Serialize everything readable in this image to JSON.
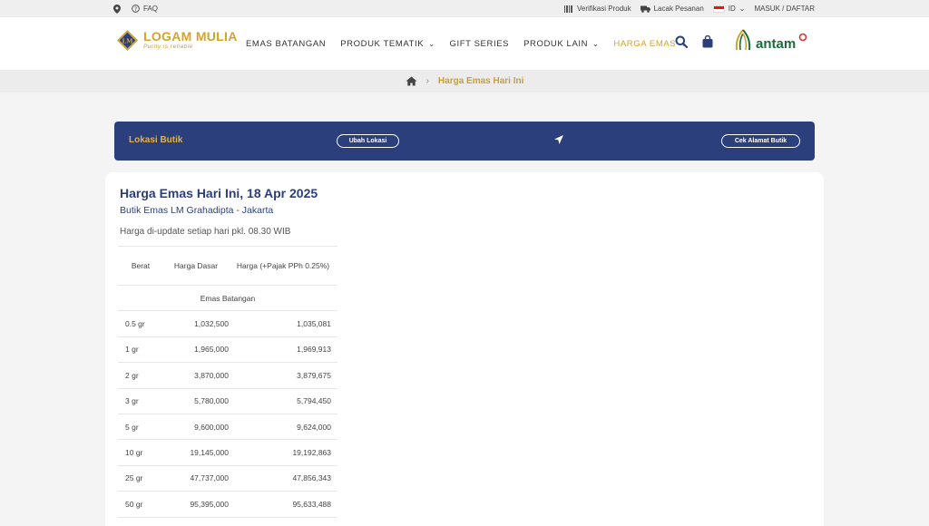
{
  "topbar": {
    "faq_label": "FAQ",
    "verify_label": "Verifikasi Produk",
    "track_label": "Lacak Pesanan",
    "lang_label": "ID",
    "login_label": "MASUK / DAFTAR"
  },
  "header": {
    "logo_name_1": "LOGAM",
    "logo_name_2": "MULIA",
    "logo_tagline": "Purity is reliable",
    "logo_mark": "LM",
    "nav": [
      {
        "label": "EMAS BATANGAN"
      },
      {
        "label": "PRODUK TEMATIK"
      },
      {
        "label": "GIFT SERIES"
      },
      {
        "label": "PRODUK LAIN"
      },
      {
        "label": "HARGA EMAS"
      }
    ],
    "partner_logo": "antam"
  },
  "breadcrumb": {
    "current": "Harga Emas Hari Ini"
  },
  "lokasi": {
    "label": "Lokasi Butik",
    "change_button": "Ubah Lokasi",
    "check_button": "Cek Alamat Butik"
  },
  "card": {
    "title": "Harga Emas Hari Ini, 18 Apr 2025",
    "subtitle": "Butik Emas LM Grahadipta - Jakarta",
    "note": "Harga di-update setiap hari pkl. 08.30 WIB"
  },
  "table": {
    "headers": [
      "Berat",
      "Harga Dasar",
      "Harga (+Pajak PPh 0.25%)"
    ],
    "category": "Emas Batangan",
    "rows": [
      {
        "weight": "0.5 gr",
        "base": "1,032,500",
        "tax": "1,035,081"
      },
      {
        "weight": "1 gr",
        "base": "1,965,000",
        "tax": "1,969,913"
      },
      {
        "weight": "2 gr",
        "base": "3,870,000",
        "tax": "3,879,675"
      },
      {
        "weight": "3 gr",
        "base": "5,780,000",
        "tax": "5,794,450"
      },
      {
        "weight": "5 gr",
        "base": "9,600,000",
        "tax": "9,624,000"
      },
      {
        "weight": "10 gr",
        "base": "19,145,000",
        "tax": "19,192,863"
      },
      {
        "weight": "25 gr",
        "base": "47,737,000",
        "tax": "47,856,343"
      },
      {
        "weight": "50 gr",
        "base": "95,395,000",
        "tax": "95,633,488"
      }
    ]
  },
  "colors": {
    "navy": "#2b3f7c",
    "gold": "#d4a32a",
    "antam_green": "#1d6b3a"
  }
}
